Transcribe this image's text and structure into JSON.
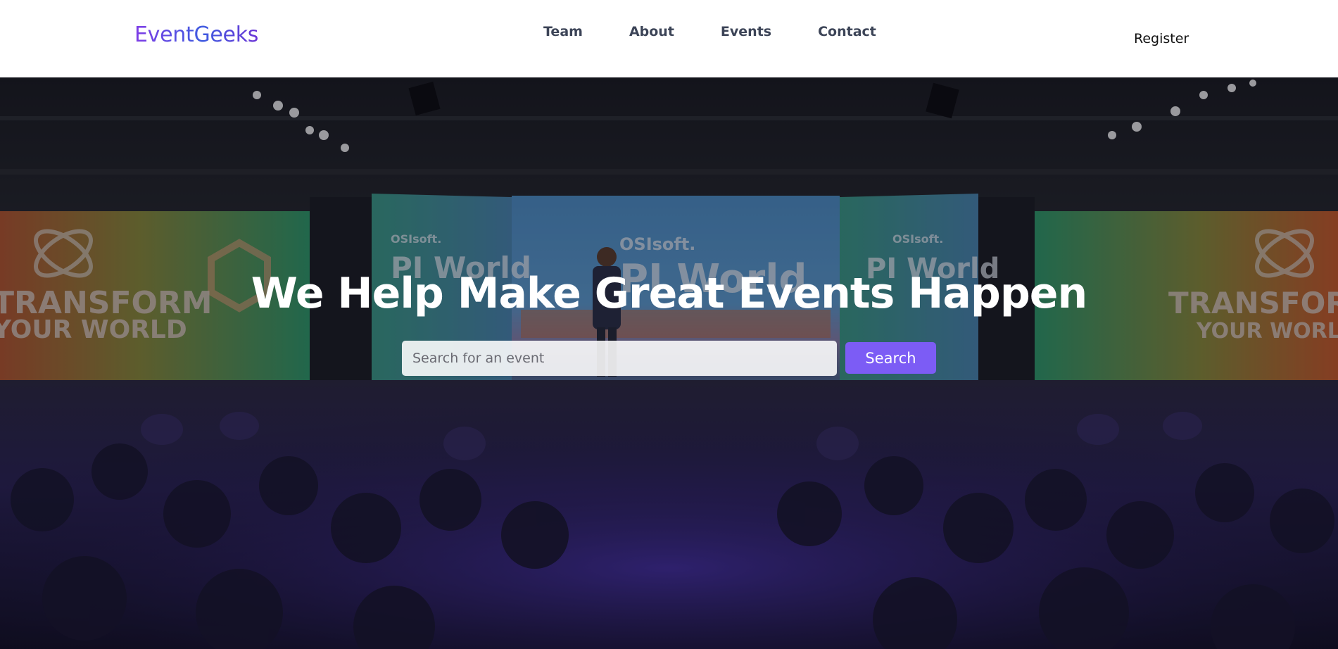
{
  "header": {
    "logo": "EventGeeks",
    "nav": [
      {
        "label": "Team"
      },
      {
        "label": "About"
      },
      {
        "label": "Events"
      },
      {
        "label": "Contact"
      }
    ],
    "register_label": "Register"
  },
  "hero": {
    "headline": "We Help Make Great Events Happen",
    "search": {
      "placeholder": "Search for an event",
      "value": "",
      "button_label": "Search"
    },
    "background_description_icon": "conference-stage-photo",
    "stage_screen_text": {
      "brand_small": "OSIsoft.",
      "brand_large": "PI World",
      "banner_line1": "TRANSFORM",
      "banner_line2": "YOUR WORLD"
    }
  },
  "colors": {
    "accent": "#7c5cf5",
    "logo_gradient_start": "#7e3ce6",
    "logo_gradient_end": "#3f5be0",
    "nav_text": "#3c4457"
  }
}
